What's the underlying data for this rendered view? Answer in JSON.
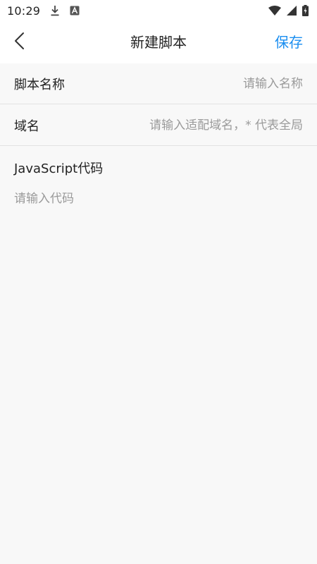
{
  "status_bar": {
    "time": "10:29",
    "icons": [
      "download-icon",
      "a-notification-icon",
      "wifi-icon",
      "cell-signal-icon",
      "battery-charging-icon"
    ]
  },
  "toolbar": {
    "title": "新建脚本",
    "save_label": "保存",
    "back_icon": "chevron-left-icon",
    "accent_color": "#1a8ef0"
  },
  "form": {
    "name": {
      "label": "脚本名称",
      "placeholder": "请输入名称",
      "value": ""
    },
    "domain": {
      "label": "域名",
      "placeholder": "请输入适配域名，* 代表全局",
      "value": ""
    },
    "code": {
      "label": "JavaScript代码",
      "placeholder": "请输入代码",
      "value": ""
    }
  }
}
